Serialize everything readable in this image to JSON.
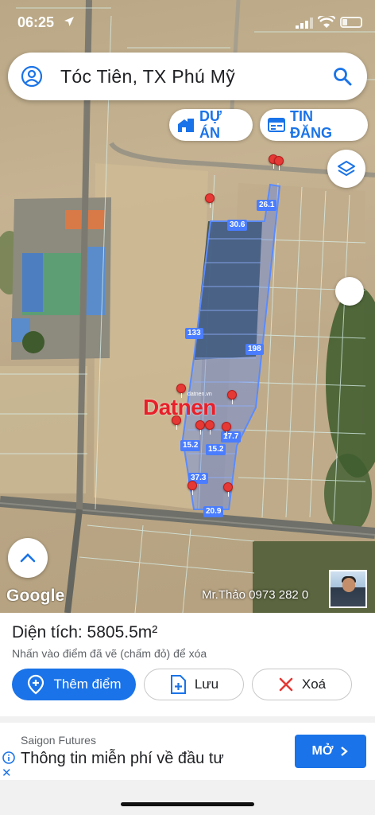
{
  "status_bar": {
    "time": "06:25"
  },
  "search": {
    "query": "Tóc Tiên, TX Phú Mỹ"
  },
  "chips": {
    "du_an": "DỰ ÁN",
    "tin_dang": "TIN ĐĂNG"
  },
  "map": {
    "dimension_labels": [
      "30.6",
      "26.1",
      "133",
      "198",
      "17.7",
      "15.2",
      "15.2",
      "37.3",
      "20.9"
    ],
    "watermark": "Datnen",
    "watermark_sub": "datnen.vn",
    "google": "Google",
    "contact": "Mr.Thảo 0973 282 0"
  },
  "panel": {
    "area": "Diện tích: 5805.5m²",
    "hint": "Nhấn vào điểm đã vẽ (chấm đỏ) để xóa",
    "add_point": "Thêm điểm",
    "save": "Lưu",
    "delete": "Xoá"
  },
  "ad": {
    "advertiser": "Saigon Futures",
    "headline": "Thông tin miễn phí về đầu tư",
    "cta": "MỞ"
  },
  "colors": {
    "accent": "#1a73e8",
    "marker": "#e53935",
    "parcel": "#4a7dff"
  }
}
